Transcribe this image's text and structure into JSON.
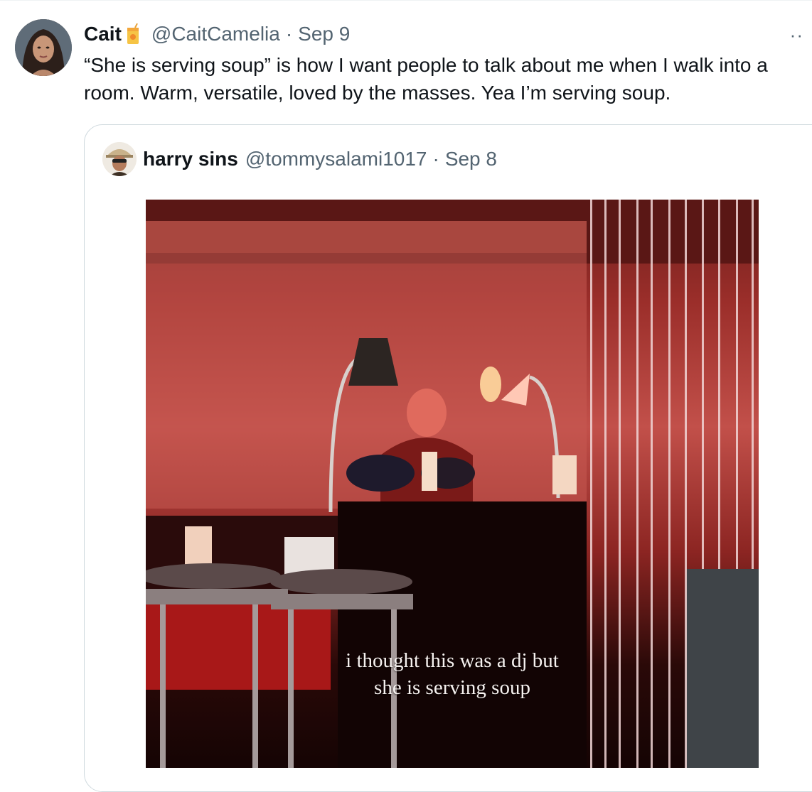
{
  "tweet": {
    "author_name": "Cait",
    "author_emoji": "juice-box-emoji",
    "handle": "@CaitCamelia",
    "separator": "·",
    "date": "Sep 9",
    "more_label": "··",
    "text": "“She is serving soup” is how I want people to talk about me when I walk into a room. Warm, versatile, loved by the masses. Yea I’m serving soup."
  },
  "quoted_tweet": {
    "author_name": "harry sins",
    "handle": "@tommysalami1017",
    "separator": "·",
    "date": "Sep 8",
    "media_caption_line1": "i thought this was a dj but",
    "media_caption_line2": "she is serving soup"
  },
  "colors": {
    "text": "#0f1419",
    "secondary_text": "#536471",
    "border": "#cfd9de",
    "background": "#ffffff"
  }
}
